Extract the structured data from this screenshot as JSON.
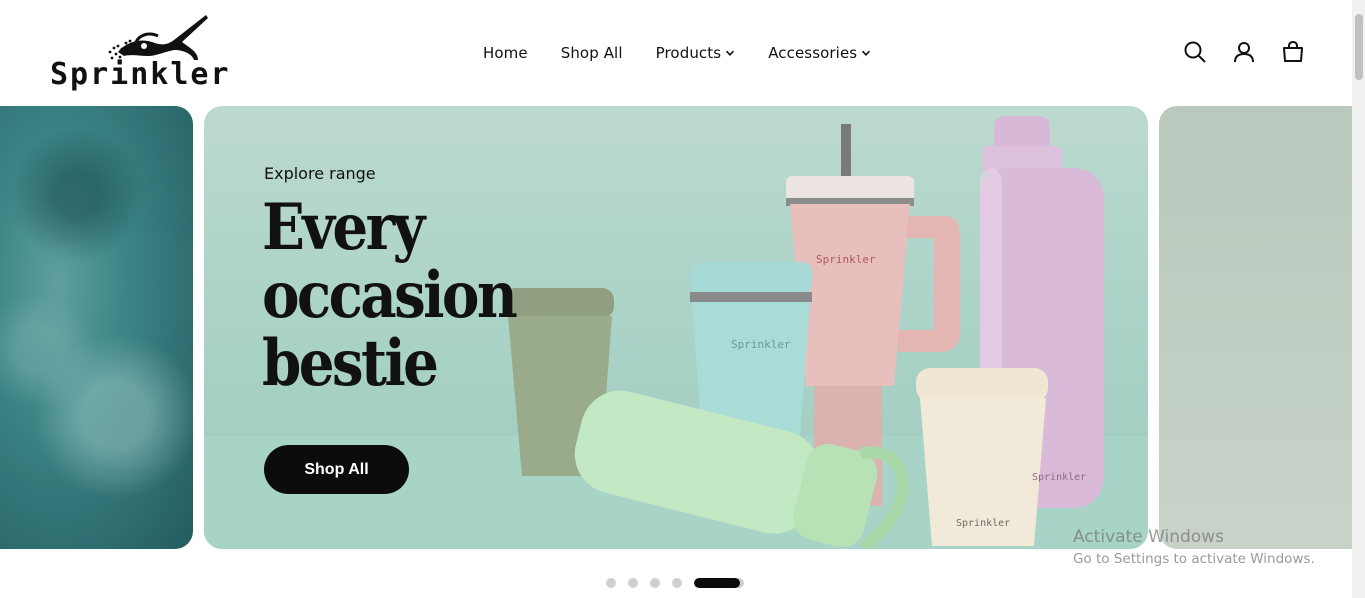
{
  "brand": {
    "name": "Sprinkler"
  },
  "nav": {
    "items": [
      {
        "label": "Home",
        "has_dropdown": false
      },
      {
        "label": "Shop All",
        "has_dropdown": false
      },
      {
        "label": "Products",
        "has_dropdown": true
      },
      {
        "label": "Accessories",
        "has_dropdown": true
      }
    ]
  },
  "header_icons": [
    "search-icon",
    "account-icon",
    "cart-icon"
  ],
  "hero": {
    "eyebrow": "Explore range",
    "headline_lines": [
      "Every",
      "occasion",
      "bestie"
    ],
    "cta_label": "Shop All",
    "product_print": "Sprinkler"
  },
  "carousel": {
    "slide_count": 5,
    "active_index": 5
  },
  "watermark": {
    "title": "Activate Windows",
    "subtitle": "Go to Settings to activate Windows."
  },
  "colors": {
    "accent": "#0c0c0c",
    "hero_bg": "#a9d2c6",
    "dot_inactive": "#cfcfcf"
  }
}
